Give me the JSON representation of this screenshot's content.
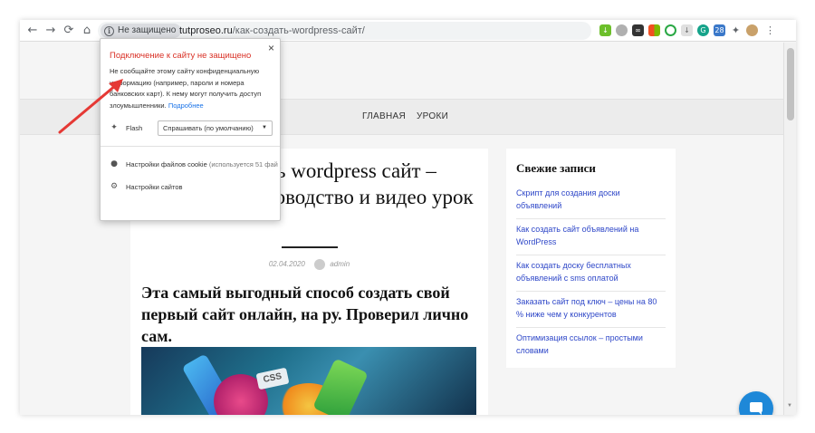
{
  "browser": {
    "nav": {
      "back": "←",
      "forward": "→",
      "reload": "⟳",
      "home": "⌂"
    },
    "security_chip": "Не защищено",
    "url_host": "tutproseo.ru",
    "url_path": "/как-создать-wordpress-сайт/",
    "star_icon": "star-icon",
    "extension_badge": "28"
  },
  "site": {
    "nav_items": [
      "ГЛАВНАЯ",
      "УРОКИ"
    ]
  },
  "article": {
    "title": "Как создать wordpress сайт – пошаговое руководство и видео урок",
    "date": "02.04.2020",
    "author": "admin",
    "lead": "Эта самый выгодный способ создать свой первый сайт онлайн, на ру. Проверил лично сам.",
    "hero_badge": "CSS"
  },
  "sidebar": {
    "heading": "Свежие записи",
    "posts": [
      "Скрипт для создания доски объявлений",
      "Как создать сайт объявлений на WordPress",
      "Как создать доску бесплатных объявлений с sms оплатой",
      "Заказать сайт под ключ – цены на 80 % ниже чем у конкурентов",
      "Оптимизация ссылок – простыми словами"
    ]
  },
  "popup": {
    "close": "×",
    "title": "Подключение к сайту не защищено",
    "body": "Не сообщайте этому сайту конфиденциальную информацию (например, пароли и номера банковских карт). К нему могут получить доступ злоумышленники.",
    "more_link": "Подробнее",
    "flash_label": "Flash",
    "flash_select": "Спрашивать (по умолчанию)",
    "cookies_label": "Настройки файлов cookie",
    "cookies_note": "(используется 51 фай",
    "site_settings": "Настройки сайтов"
  },
  "colors": {
    "warning_red": "#d93025",
    "link_blue": "#2e47c8",
    "chat_blue": "#1e88d8",
    "annotation_arrow": "#e53935"
  }
}
